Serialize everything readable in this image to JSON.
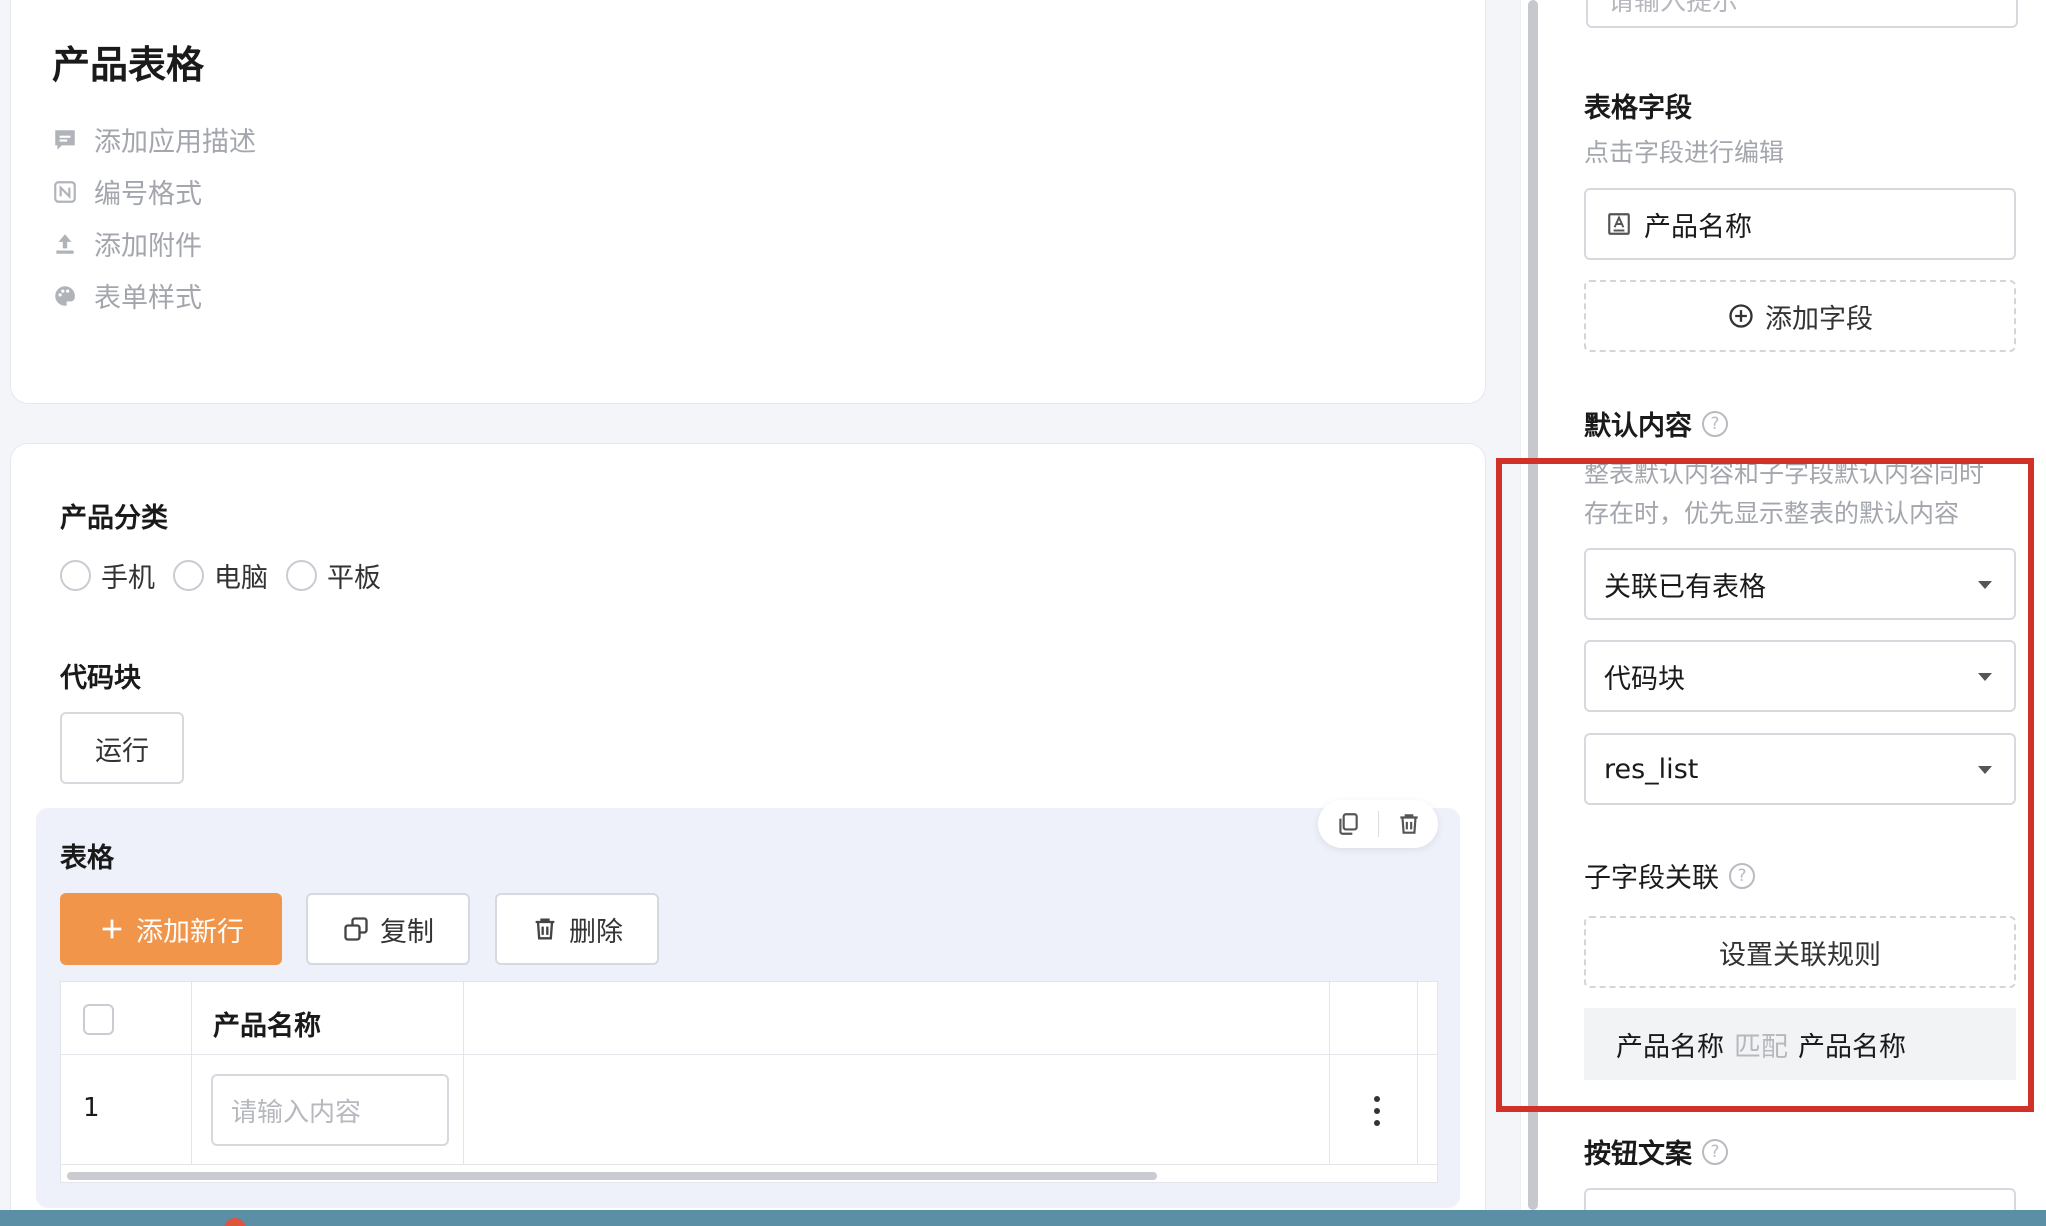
{
  "app": {
    "title": "产品表格",
    "meta": {
      "description": "添加应用描述",
      "numbering": "编号格式",
      "attachment": "添加附件",
      "form_style": "表单样式"
    }
  },
  "form": {
    "category": {
      "label": "产品分类",
      "options": [
        "手机",
        "电脑",
        "平板"
      ]
    },
    "code_block": {
      "label": "代码块",
      "run_label": "运行"
    },
    "table": {
      "label": "表格",
      "add_row": "添加新行",
      "copy": "复制",
      "delete": "删除",
      "column_header": "产品名称",
      "rows": [
        {
          "index": "1",
          "placeholder": "请输入内容"
        }
      ]
    }
  },
  "panel": {
    "top_input_placeholder": "请输入提示",
    "fields": {
      "title": "表格字段",
      "subtitle": "点击字段进行编辑",
      "items": [
        "产品名称"
      ],
      "add_label": "添加字段"
    },
    "default_content": {
      "title": "默认内容",
      "hint": "整表默认内容和子字段默认内容同时存在时，优先显示整表的默认内容",
      "hint_line1": "整表默认内容和子字段默认内容同时",
      "hint_line2": "存在时，优先显示整表的默认内容",
      "select_source": "关联已有表格",
      "select_table": "代码块",
      "select_var": "res_list"
    },
    "sub_field": {
      "title": "子字段关联",
      "rule_button": "设置关联规则",
      "match": {
        "left": "产品名称",
        "op": "匹配",
        "right": "产品名称"
      }
    },
    "button_text": {
      "title": "按钮文案"
    }
  },
  "colors": {
    "accent_orange": "#f0954a",
    "highlight_red": "#d0322a",
    "table_block_bg": "#eef0fa"
  }
}
